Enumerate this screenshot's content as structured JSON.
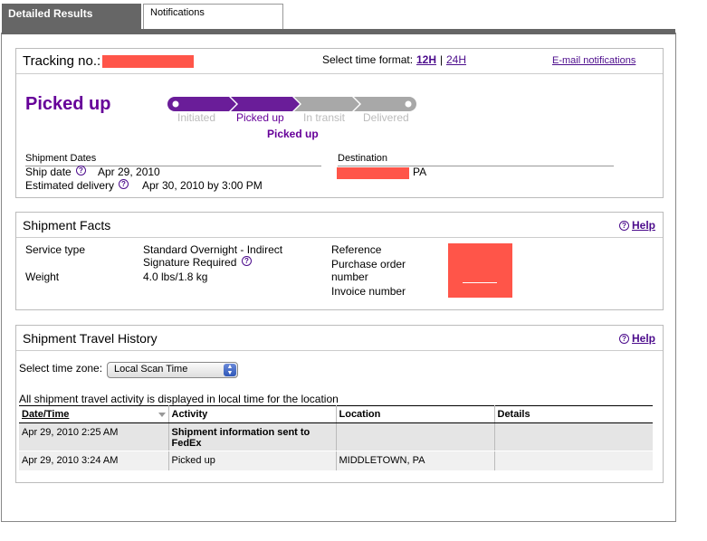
{
  "tabs": [
    {
      "label": "Detailed Results",
      "active": true
    },
    {
      "label": "Notifications",
      "active": false
    }
  ],
  "tracking": {
    "label": "Tracking no.:",
    "time_format_label": "Select time format:",
    "format_12h": "12H",
    "format_sep": "|",
    "format_24h": "24H",
    "email_link": "E-mail notifications",
    "status": "Picked up",
    "stages": [
      "Initiated",
      "Picked up",
      "In transit",
      "Delivered"
    ],
    "current_stage_index": 1,
    "current_stage_label": "Picked up",
    "shipment_dates_heading": "Shipment Dates",
    "ship_date_label": "Ship date",
    "ship_date_value": "Apr 29, 2010",
    "est_delivery_label": "Estimated delivery",
    "est_delivery_value": "Apr 30, 2010 by 3:00 PM",
    "destination_heading": "Destination",
    "destination_state": "PA"
  },
  "facts": {
    "title": "Shipment Facts",
    "help_label": "Help",
    "service_type_label": "Service type",
    "service_type_line1": "Standard Overnight - Indirect",
    "service_type_line2": "Signature Required",
    "weight_label": "Weight",
    "weight_value": "4.0 lbs/1.8 kg",
    "reference_label": "Reference",
    "po_label_line1": "Purchase order",
    "po_label_line2": "number",
    "invoice_label": "Invoice number"
  },
  "history": {
    "title": "Shipment Travel History",
    "help_label": "Help",
    "timezone_label": "Select time zone:",
    "timezone_value": "Local Scan Time",
    "note": "All shipment travel activity is displayed in local time for the location",
    "columns": [
      "Date/Time",
      "Activity",
      "Location",
      "Details"
    ],
    "rows": [
      {
        "datetime": "Apr 29, 2010 2:25 AM",
        "activity_line1": "Shipment information sent to",
        "activity_line2": "FedEx",
        "location": "",
        "details": ""
      },
      {
        "datetime": "Apr 29, 2010 3:24 AM",
        "activity_line1": "Picked up",
        "activity_line2": "",
        "location": "MIDDLETOWN, PA",
        "details": ""
      }
    ]
  },
  "colors": {
    "brand_purple": "#660099",
    "tab_gray": "#666666",
    "redaction": "#ff5549"
  }
}
